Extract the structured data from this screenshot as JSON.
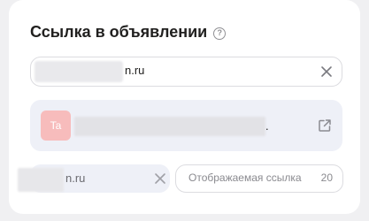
{
  "section": {
    "title": "Ссылка в объявлении",
    "help_icon_glyph": "?"
  },
  "url_field": {
    "value_suffix": "n.ru",
    "clear_icon": "close-icon"
  },
  "preview": {
    "avatar_initials": "Ta",
    "avatar_color": "#f7bcbc",
    "trailing_text": ".",
    "open_icon": "external-link-icon"
  },
  "short_link": {
    "value_suffix": "n.ru",
    "clear_icon": "close-icon"
  },
  "display_link": {
    "placeholder": "Отображаемая ссылка",
    "counter": "20"
  }
}
